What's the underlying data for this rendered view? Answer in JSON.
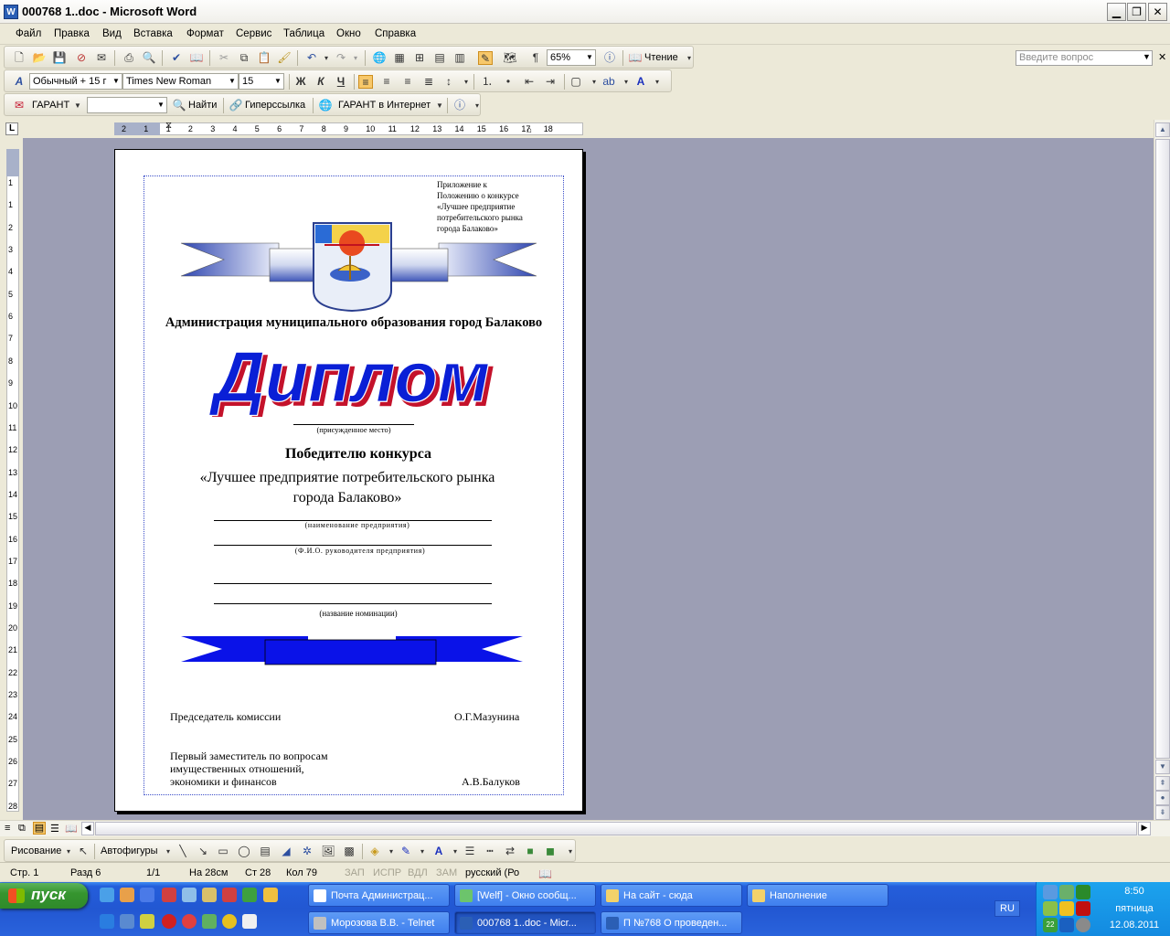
{
  "window": {
    "title": "000768 1..doc - Microsoft Word",
    "icon_letter": "W"
  },
  "menu": [
    "Файл",
    "Правка",
    "Вид",
    "Вставка",
    "Формат",
    "Сервис",
    "Таблица",
    "Окно",
    "Справка"
  ],
  "ask_placeholder": "Введите вопрос",
  "toolbar_standard": {
    "zoom": "65%",
    "reading_label": "Чтение"
  },
  "toolbar_format": {
    "style": "Обычный + 15 г",
    "font": "Times New Roman",
    "size": "15",
    "bold": "Ж",
    "italic": "К",
    "underline": "Ч"
  },
  "toolbar_garant": {
    "garant": "ГАРАНТ",
    "find": "Найти",
    "hyperlink": "Гиперссылка",
    "internet": "ГАРАНТ в Интернет"
  },
  "hruler": [
    "2",
    "1",
    "1",
    "2",
    "3",
    "4",
    "5",
    "6",
    "7",
    "8",
    "9",
    "10",
    "11",
    "12",
    "13",
    "14",
    "15",
    "16",
    "17",
    "18"
  ],
  "vruler": [
    "1",
    "1",
    "2",
    "3",
    "4",
    "5",
    "6",
    "7",
    "8",
    "9",
    "10",
    "11",
    "12",
    "13",
    "14",
    "15",
    "16",
    "17",
    "18",
    "19",
    "20",
    "21",
    "22",
    "23",
    "24",
    "25",
    "26",
    "27",
    "28"
  ],
  "document": {
    "appendix": [
      "Приложение к",
      "Положению о конкурсе",
      "«Лучшее предприятие",
      "потребительского рынка",
      "города Балаково»"
    ],
    "admin": "Администрация муниципального образования город Балаково",
    "diploma": "Диплом",
    "place_caption": "(присужденное место)",
    "winner": "Победителю конкурса",
    "contest_line1": "«Лучшее предприятие потребительского рынка",
    "contest_line2": "города Балаково»",
    "org_caption": "(наименование предприятия)",
    "head_caption": "(Ф.И.О. руководителя предприятия)",
    "nomination_caption": "(название номинации)",
    "chairman_title": "Председатель комиссии",
    "chairman_name": "О.Г.Мазунина",
    "deputy_line1": "Первый заместитель по вопросам",
    "deputy_line2": "имущественных отношений,",
    "deputy_line3": "экономики и финансов",
    "deputy_name": "А.В.Балуков"
  },
  "drawing": {
    "draw": "Рисование",
    "autoshapes": "Автофигуры"
  },
  "status": {
    "page": "Стр. 1",
    "section": "Разд 6",
    "pages": "1/1",
    "at": "На 28см",
    "line": "Ст 28",
    "col": "Кол 79",
    "rec": "ЗАП",
    "trk": "ИСПР",
    "ext": "ВДЛ",
    "ovr": "ЗАМ",
    "lang": "русский (Ро"
  },
  "taskbar": {
    "start": "пуск",
    "row1": [
      "Почта Администрац...",
      "[Welf] - Окно сообщ...",
      "На сайт - сюда",
      "Наполнение"
    ],
    "row2": [
      "Морозова В.В. - Telnet",
      "000768 1..doc - Micr...",
      "П №768 О проведен..."
    ],
    "lang": "RU",
    "time": "8:50",
    "day": "пятница",
    "date": "12.08.2011"
  },
  "colors": {
    "accent": "#0a1fd6",
    "diploma_shadow": "#c4122b",
    "ribbon": "#0a12e8",
    "workspace": "#9c9eb4"
  }
}
